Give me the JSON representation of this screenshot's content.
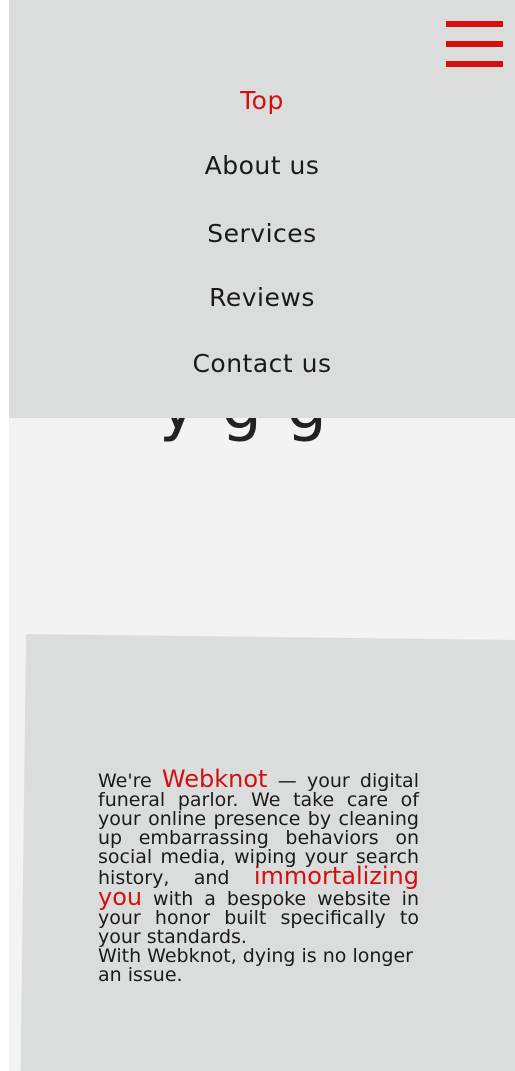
{
  "nav": {
    "items": [
      {
        "label": "Top",
        "active": true
      },
      {
        "label": "About us",
        "active": false
      },
      {
        "label": "Services",
        "active": false
      },
      {
        "label": "Reviews",
        "active": false
      },
      {
        "label": "Contact us",
        "active": false
      }
    ],
    "menu_icon": "hamburger-menu-icon"
  },
  "hero": {
    "peek_text": "y g g"
  },
  "intro": {
    "prefix": "We're ",
    "brand": "Webknot",
    "part1": " — your digital funeral parlor. We take care of your online presence by cleaning up embarrassing behaviors on social media, wiping your search history, and ",
    "highlight": "immortalizing you",
    "part2": " with a bespoke website in your honor built specifically to your standards.",
    "closing": "With Webknot, dying is no longer an issue."
  },
  "colors": {
    "accent": "#d40f0f",
    "panel": "#dbdddd",
    "background": "#f2f3f2",
    "text": "#1a1a1a"
  }
}
